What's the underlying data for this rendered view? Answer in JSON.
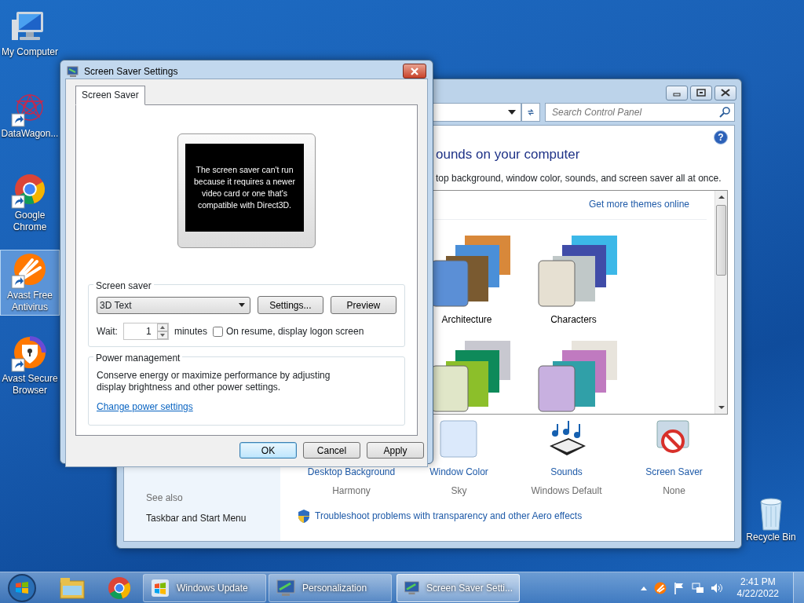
{
  "desktop": {
    "icons": [
      {
        "label": "My Computer",
        "kind": "computer",
        "shortcut": false,
        "selected": false
      },
      {
        "label": "DataWagon...",
        "kind": "datawagon",
        "shortcut": true,
        "selected": false
      },
      {
        "label": "Google Chrome",
        "kind": "chrome",
        "shortcut": true,
        "selected": false
      },
      {
        "label": "Avast Free Antivirus",
        "kind": "avast",
        "shortcut": true,
        "selected": true
      },
      {
        "label": "Avast Secure Browser",
        "kind": "avast-browser",
        "shortcut": true,
        "selected": false
      }
    ],
    "recycle_bin": {
      "label": "Recycle Bin"
    }
  },
  "control_panel": {
    "search": {
      "placeholder": "Search Control Panel"
    },
    "help_button": "?",
    "heading": "ounds on your computer",
    "description": "top background, window color, sounds, and screen saver all at once.",
    "themes_link": "Get more themes online",
    "themes": [
      {
        "label": "Architecture",
        "kind": "architecture"
      },
      {
        "label": "Characters",
        "kind": "characters"
      },
      {
        "kind": "landscapes"
      },
      {
        "kind": "nature"
      }
    ],
    "settings": [
      {
        "kind": "desktop-background",
        "label": "Desktop Background",
        "value": "Harmony"
      },
      {
        "kind": "window-color",
        "label": "Window Color",
        "value": "Sky"
      },
      {
        "kind": "sounds",
        "label": "Sounds",
        "value": "Windows Default"
      },
      {
        "kind": "screen-saver",
        "label": "Screen Saver",
        "value": "None"
      }
    ],
    "see_also": {
      "title": "See also",
      "links": [
        "Taskbar and Start Menu"
      ]
    },
    "troubleshoot_link": "Troubleshoot problems with transparency and other Aero effects"
  },
  "dialog": {
    "title": "Screen Saver Settings",
    "tabs": [
      {
        "label": "Screen Saver",
        "selected": true
      }
    ],
    "preview_message": "The screen saver can't run because it requires a newer video card or one that's compatible with Direct3D.",
    "screen_saver_group": {
      "title": "Screen saver",
      "selected_value": "3D Text",
      "buttons": [
        "Settings...",
        "Preview"
      ],
      "wait_label": "Wait:",
      "wait_value": "1",
      "wait_unit": "minutes",
      "logon_checkbox": {
        "label": "On resume, display logon screen",
        "checked": false
      }
    },
    "power_group": {
      "title": "Power management",
      "text": "Conserve energy or maximize performance by adjusting display brightness and other power settings.",
      "link": "Change power settings"
    },
    "buttons": [
      {
        "label": "OK",
        "default": true
      },
      {
        "label": "Cancel",
        "default": false
      },
      {
        "label": "Apply",
        "default": false
      }
    ]
  },
  "taskbar": {
    "pinned": [
      {
        "kind": "explorer"
      },
      {
        "kind": "chrome"
      }
    ],
    "tasks": [
      {
        "label": "Windows Update",
        "kind": "update",
        "selected": false
      },
      {
        "label": "Personalization",
        "kind": "personalization",
        "selected": false
      },
      {
        "label": "Screen Saver Setti...",
        "kind": "screensaver",
        "selected": true
      }
    ],
    "time": "2:41 PM",
    "date": "4/22/2022"
  }
}
